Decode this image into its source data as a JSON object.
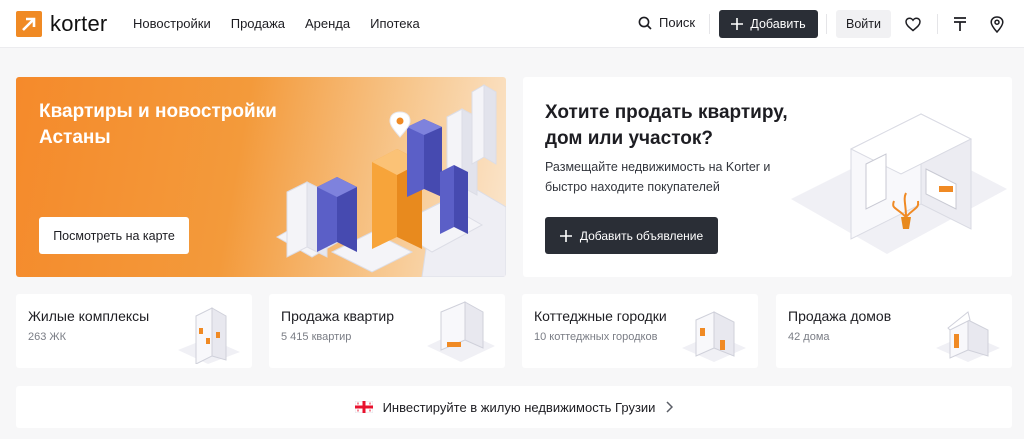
{
  "brand": {
    "name": "korter",
    "accent": "#f08a24"
  },
  "nav": [
    "Новостройки",
    "Продажа",
    "Аренда",
    "Ипотека"
  ],
  "header": {
    "search_label": "Поиск",
    "add_label": "Добавить",
    "login_label": "Войти",
    "icons": [
      "heart-icon",
      "ruble-icon",
      "location-pin-icon"
    ]
  },
  "hero": {
    "title": "Квартиры и новостройки Астаны",
    "button": "Посмотреть на карте"
  },
  "sell": {
    "title": "Хотите продать квартиру, дом или участок?",
    "text": "Размещайте недвижимость на Korter и быстро находите покупателей",
    "button": "Добавить объявление"
  },
  "categories": [
    {
      "title": "Жилые комплексы",
      "sub": "263 ЖК"
    },
    {
      "title": "Продажа квартир",
      "sub": "5 415 квартир"
    },
    {
      "title": "Коттеджные городки",
      "sub": "10 коттеджных городков"
    },
    {
      "title": "Продажа домов",
      "sub": "42 дома"
    }
  ],
  "invest": {
    "label": "Инвестируйте в жилую недвижимость Грузии"
  },
  "colors": {
    "dark_button": "#2a2e36",
    "orange": "#f58a2b",
    "building_blue": "#5b5fc7"
  }
}
